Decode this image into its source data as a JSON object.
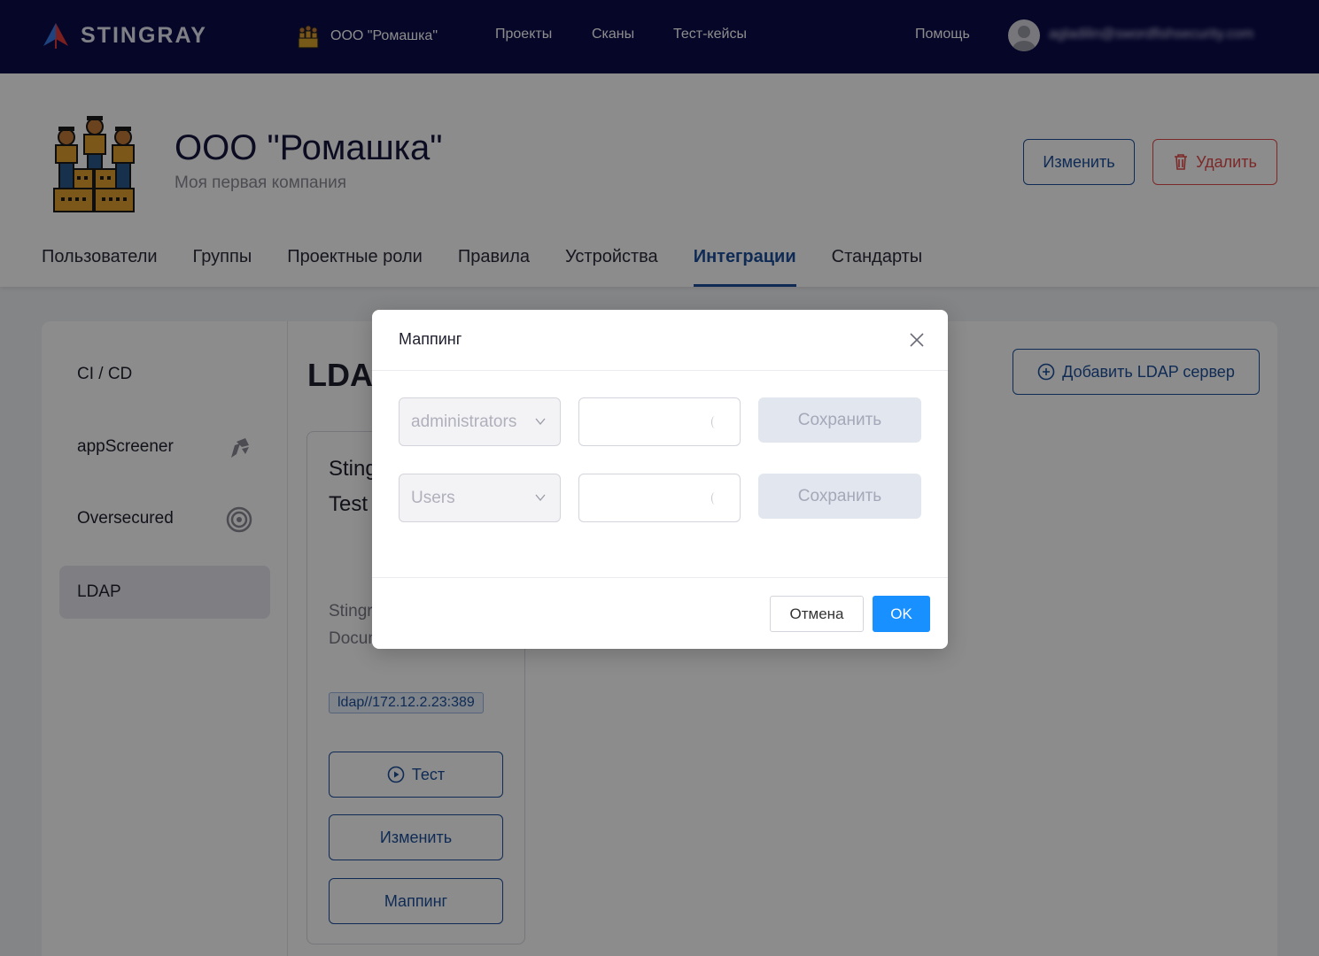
{
  "topnav": {
    "brand": "STINGRAY",
    "org_name": "ООО \"Ромашка\"",
    "links": [
      "Проекты",
      "Сканы",
      "Тест-кейсы"
    ],
    "help": "Помощь",
    "user_email": "agladilin@swordfishsecurity.com"
  },
  "company": {
    "title": "ООО \"Ромашка\"",
    "subtitle": "Моя первая компания",
    "edit_label": "Изменить",
    "delete_label": "Удалить"
  },
  "tabs": [
    "Пользователи",
    "Группы",
    "Проектные роли",
    "Правила",
    "Устройства",
    "Интеграции",
    "Стандарты"
  ],
  "active_tab": "Интеграции",
  "sidebar": {
    "items": [
      {
        "label": "CI / CD",
        "icon": ""
      },
      {
        "label": "appScreener",
        "icon": "appscreener-icon"
      },
      {
        "label": "Oversecured",
        "icon": "oversecured-icon"
      },
      {
        "label": "LDAP",
        "icon": ""
      }
    ],
    "active": "LDAP"
  },
  "content": {
    "title": "LDAP",
    "add_button": "Добавить LDAP сервер",
    "card": {
      "title": "Stingray LDAP Test Server",
      "description": "Stingray Server Documentation",
      "url": "ldap//172.12.2.23:389",
      "test_label": "Тест",
      "edit_label": "Изменить",
      "mapping_label": "Маппинг"
    }
  },
  "modal": {
    "title": "Маппинг",
    "rows": [
      {
        "group": "administrators",
        "value": "",
        "save_label": "Сохранить"
      },
      {
        "group": "Users",
        "value": "",
        "save_label": "Сохранить"
      }
    ],
    "cancel_label": "Отмена",
    "ok_label": "OK"
  },
  "colors": {
    "nav_bg": "#0b0b4b",
    "accent": "#1c4f9c",
    "danger": "#e24a4a",
    "primary_btn": "#1890ff"
  }
}
